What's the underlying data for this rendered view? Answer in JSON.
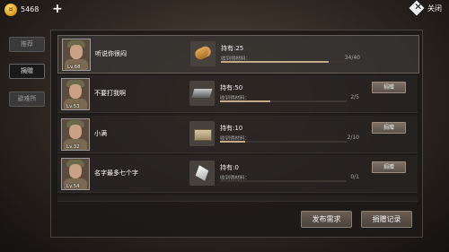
{
  "top_bar": {
    "coins": "5468",
    "plus_icon": "plus-icon",
    "close_label": "关闭"
  },
  "side_tabs": [
    {
      "label": "推荐",
      "active": false
    },
    {
      "label": "捐赠",
      "active": true
    },
    {
      "label": "避难所",
      "active": false
    }
  ],
  "rows": [
    {
      "level": "Lv.68",
      "name": "听说你很闷",
      "material_icon": "wood-log-icon",
      "owned": "持有:25",
      "received_label": "收到得材料：",
      "progress": "34/40",
      "progress_fraction": 0.85,
      "show_donate": false,
      "highlight": true
    },
    {
      "level": "Lv.53",
      "name": "不要打我啊",
      "material_icon": "steel-ingot-icon",
      "owned": "持有:50",
      "received_label": "收到得材料：",
      "progress": "2/5",
      "progress_fraction": 0.4,
      "show_donate": true,
      "donate_label": "捐赠",
      "highlight": false
    },
    {
      "level": "Lv.32",
      "name": "小满",
      "material_icon": "cloth-bundle-icon",
      "owned": "持有:10",
      "received_label": "收到得材料：",
      "progress": "2/10",
      "progress_fraction": 0.2,
      "show_donate": true,
      "donate_label": "捐赠",
      "highlight": false
    },
    {
      "level": "Lv.54",
      "name": "名字最多七个字",
      "material_icon": "crystal-shard-icon",
      "owned": "持有:0",
      "received_label": "收到得材料：",
      "progress": "0/1",
      "progress_fraction": 0.0,
      "show_donate": true,
      "donate_label": "捐赠",
      "highlight": false
    }
  ],
  "footer": {
    "publish_label": "发布需求",
    "record_label": "捐赠记录"
  }
}
